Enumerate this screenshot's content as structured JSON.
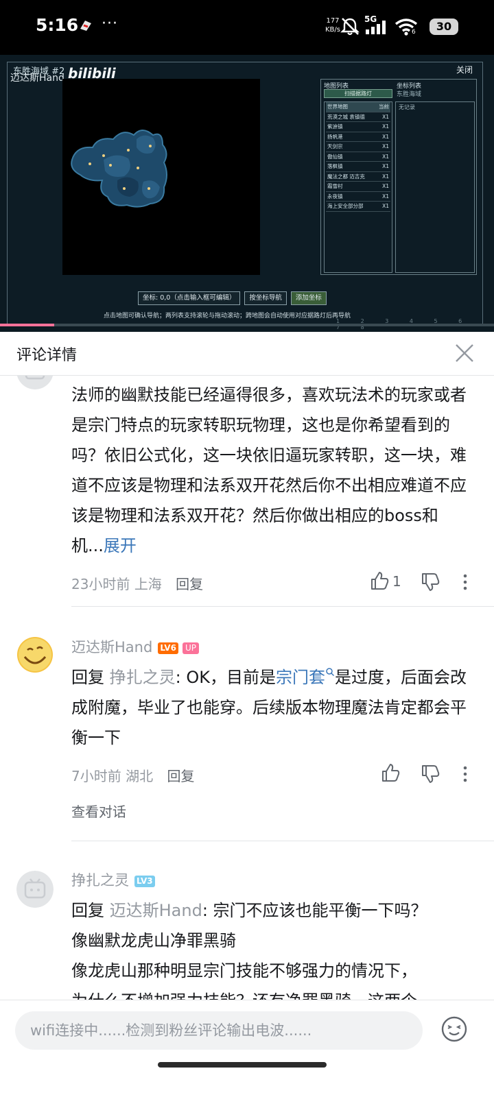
{
  "status_bar": {
    "time": "5:16",
    "more": "···",
    "net_speed_value": "177",
    "net_speed_unit": "KB/s",
    "network": "5G",
    "wifi_level": "6",
    "battery": "30"
  },
  "video": {
    "game_title": "东胜海域 #2",
    "watermark": "迈达斯Hand",
    "brand": "bilibili",
    "close_label": "关闭",
    "map_list_header": "地图列表",
    "coord_list_header": "坐标列表",
    "coord_list_sub": "东胜海域",
    "scan_button": "扫描据路灯",
    "coord_empty": "无记录",
    "map_items": [
      {
        "name": "世界地图",
        "tag": "当前"
      },
      {
        "name": "荒漠之城 袁镇德",
        "tag": "X1"
      },
      {
        "name": "紫迪镇",
        "tag": "X1"
      },
      {
        "name": "扬帆港",
        "tag": "X1"
      },
      {
        "name": "天剑宗",
        "tag": "X1"
      },
      {
        "name": "傲仙镇",
        "tag": "X1"
      },
      {
        "name": "落枫镇",
        "tag": "X1"
      },
      {
        "name": "魔法之都 迈吉克",
        "tag": "X1"
      },
      {
        "name": "霜雪村",
        "tag": "X1"
      },
      {
        "name": "永夜镇",
        "tag": "X1"
      },
      {
        "name": "海上安全部分部",
        "tag": "X1"
      }
    ],
    "coord_input": "坐标: 0,0（点击输入框可编辑）",
    "nav_button": "按坐标导航",
    "add_button": "添加坐标",
    "hint": "点击地图可确认导航；两列表支持滚轮与拖动滚动；跨地图会自动使用对应据路灯后再导航",
    "progress": 0.11,
    "page_numbers": "1 2 3 4 5 6 7 8"
  },
  "sheet": {
    "title": "评论详情"
  },
  "comments": [
    {
      "text": "法师的幽默技能已经逼得很多，喜欢玩法术的玩家或者是宗门特点的玩家转职玩物理，这也是你希望看到的吗？依旧公式化，这一块依旧逼玩家转职，这一块，难道不应该是物理和法系双开花然后你不出相应难道不应该是物理和法系双开花？然后你做出相应的boss和机...",
      "expand": "展开",
      "time": "23小时前",
      "location": "上海",
      "reply": "回复",
      "likes": "1"
    },
    {
      "user": "迈达斯Hand",
      "level": "LV6",
      "badge": "UP",
      "reply_prefix": "回复",
      "reply_to": "挣扎之灵",
      "text_a": ": OK，目前是",
      "keyword": "宗门套",
      "text_b": "是过度，后面会改成附魔，毕业了也能穿。后续版本物理魔法肯定都会平衡一下",
      "time": "7小时前",
      "location": "湖北",
      "reply": "回复",
      "see_conversation": "查看对话"
    },
    {
      "user": "挣扎之灵",
      "level": "LV3",
      "reply_prefix": "回复",
      "reply_to": "迈达斯Hand",
      "line1": ": 宗门不应该也能平衡一下吗？",
      "line2": "像幽默龙虎山净罪黑骑",
      "line3": "像龙虎山那种明显宗门技能不够强力的情况下，",
      "line4": "为什么不增加强力技能？还有净罪黑骑，这两个"
    }
  ],
  "input": {
    "placeholder": "wifi连接中......检测到粉丝评论输出电波......"
  },
  "colors": {
    "pink": "#fb7299",
    "link_blue": "#3b77b9",
    "lv6": "#ff6c00",
    "lv3": "#7bcdef"
  }
}
